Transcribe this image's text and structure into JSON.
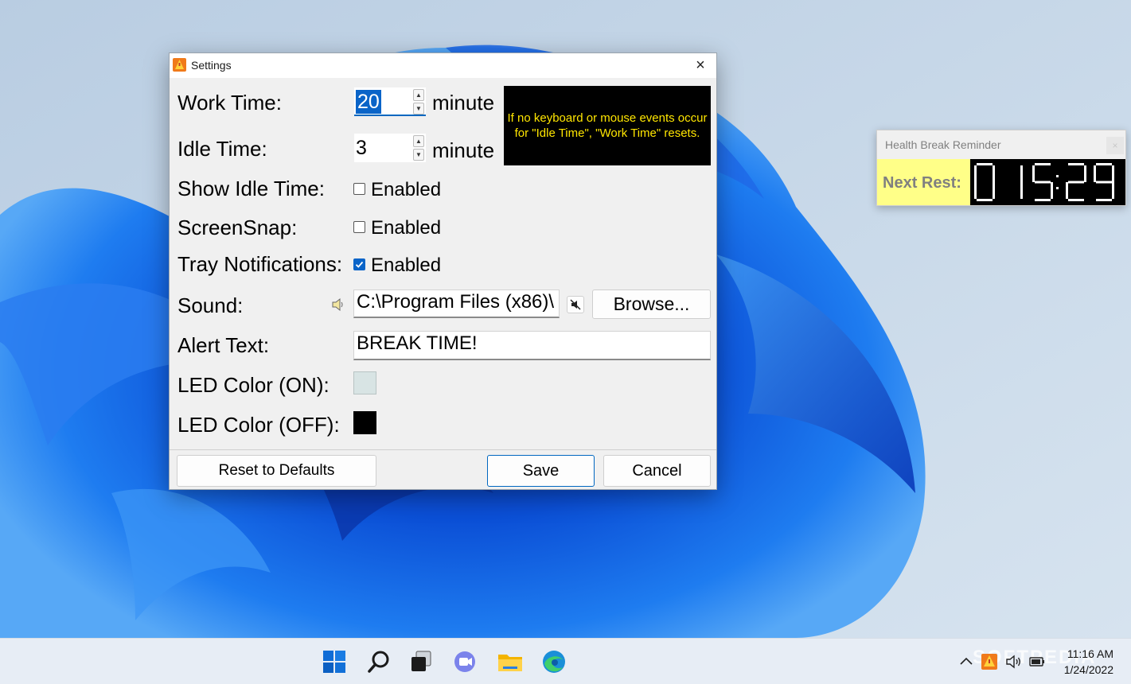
{
  "settings_dialog": {
    "title": "Settings",
    "close_glyph": "×",
    "work_time": {
      "label": "Work Time:",
      "value": "20",
      "unit": "minute"
    },
    "idle_time": {
      "label": "Idle Time:",
      "value": "3",
      "unit": "minute"
    },
    "info_text": "If no keyboard or mouse events occur for \"Idle Time\", \"Work Time\" resets.",
    "show_idle_time": {
      "label": "Show Idle Time:",
      "option": "Enabled",
      "checked": false
    },
    "screen_snap": {
      "label": "ScreenSnap:",
      "option": "Enabled",
      "checked": false
    },
    "tray_notifications": {
      "label": "Tray Notifications:",
      "option": "Enabled",
      "checked": true
    },
    "sound": {
      "label": "Sound:",
      "path": "C:\\Program Files (x86)\\",
      "browse_label": "Browse..."
    },
    "alert_text": {
      "label": "Alert Text:",
      "value": "BREAK TIME!"
    },
    "led_color_on": {
      "label": "LED Color (ON):",
      "color": "#d8e4e4"
    },
    "led_color_off": {
      "label": "LED Color (OFF):",
      "color": "#000000"
    },
    "buttons": {
      "reset": "Reset to Defaults",
      "save": "Save",
      "cancel": "Cancel"
    }
  },
  "widget": {
    "title": "Health Break Reminder",
    "close_glyph": "×",
    "label": "Next Rest:",
    "time_digits": "0 1 5 2 9",
    "led_color": "#ffffff"
  },
  "taskbar": {
    "icons": [
      "windows-start-icon",
      "search-icon",
      "task-view-icon",
      "chat-icon",
      "file-explorer-icon",
      "edge-icon"
    ],
    "tray_icons": [
      "chevron-up-icon",
      "health-break-tray-icon",
      "volume-icon",
      "battery-icon"
    ],
    "time": "11:16 AM",
    "date": "1/24/2022",
    "watermark": "SOFTPEDIA"
  },
  "colors": {
    "accent": "#0067c0",
    "info_text": "#ffe600",
    "widget_label_bg": "#ffff88"
  }
}
